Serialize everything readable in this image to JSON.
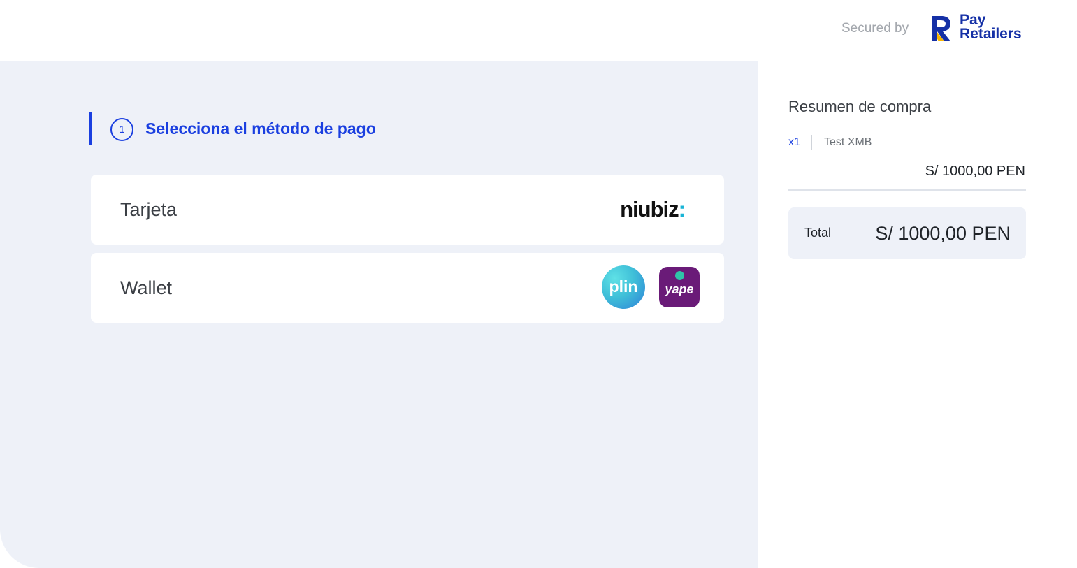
{
  "header": {
    "secured_by": "Secured by",
    "brand_line1": "Pay",
    "brand_line2": "Retailers",
    "brand_color": "#1530a6",
    "brand_accent": "#f7b500"
  },
  "step": {
    "number": "1",
    "title": "Selecciona el método de pago",
    "accent_color": "#1a3fe0"
  },
  "methods": [
    {
      "label": "Tarjeta",
      "providers": [
        {
          "logo": "niubiz-logo",
          "text": "niubiz"
        }
      ]
    },
    {
      "label": "Wallet",
      "providers": [
        {
          "logo": "plin-logo",
          "text": "plin"
        },
        {
          "logo": "yape-logo",
          "text": "yape"
        }
      ]
    }
  ],
  "summary": {
    "title": "Resumen de compra",
    "items": [
      {
        "quantity": "x1",
        "name": "Test XMB",
        "price": "S/ 1000,00 PEN"
      }
    ],
    "total_label": "Total",
    "total_value": "S/ 1000,00 PEN"
  }
}
